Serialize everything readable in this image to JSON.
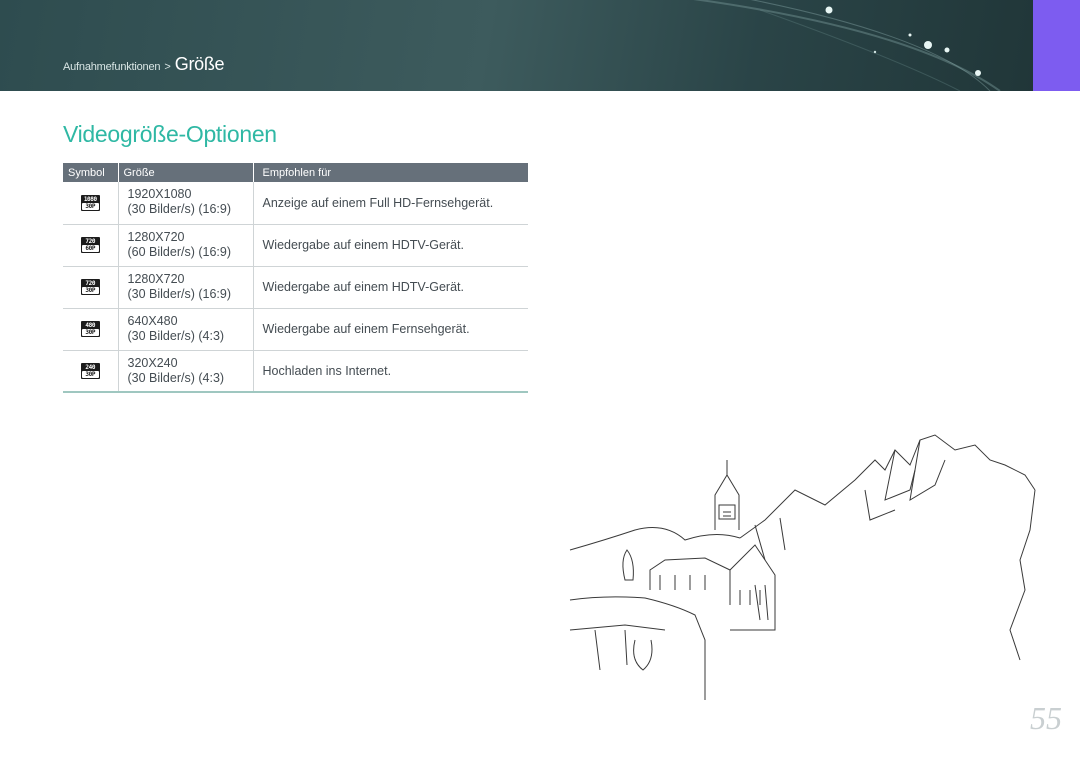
{
  "header": {
    "breadcrumb_parent": "Aufnahmefunktionen",
    "breadcrumb_separator": ">",
    "breadcrumb_current": "Größe"
  },
  "section": {
    "title": "Videogröße-Optionen"
  },
  "table": {
    "columns": [
      "Symbol",
      "Größe",
      "Empfohlen für"
    ],
    "rows": [
      {
        "icon": "video-1080-30p-icon",
        "icon_top": "1080",
        "icon_bottom": "30P",
        "size": "1920X1080",
        "rate": "(30 Bilder/s) (16:9)",
        "recommended": "Anzeige auf einem Full HD-Fernsehgerät."
      },
      {
        "icon": "video-720-60p-icon",
        "icon_top": "720",
        "icon_bottom": "60P",
        "size": "1280X720",
        "rate": "(60 Bilder/s) (16:9)",
        "recommended": "Wiedergabe auf einem HDTV-Gerät."
      },
      {
        "icon": "video-720-30p-icon",
        "icon_top": "720",
        "icon_bottom": "30P",
        "size": "1280X720",
        "rate": "(30 Bilder/s) (16:9)",
        "recommended": "Wiedergabe auf einem HDTV-Gerät."
      },
      {
        "icon": "video-480-30p-icon",
        "icon_top": "480",
        "icon_bottom": "30P",
        "size": "640X480",
        "rate": "(30 Bilder/s) (4:3)",
        "recommended": "Wiedergabe auf einem Fernsehgerät."
      },
      {
        "icon": "video-240-30p-icon",
        "icon_top": "240",
        "icon_bottom": "30P",
        "size": "320X240",
        "rate": "(30 Bilder/s) (4:3)",
        "recommended": "Hochladen ins Internet."
      }
    ]
  },
  "page_number": "55",
  "colors": {
    "header_bg": "#2e4c4f",
    "side_tab": "#7d5cf0",
    "title_accent": "#2fb8a4",
    "table_header_bg": "#66707a"
  }
}
